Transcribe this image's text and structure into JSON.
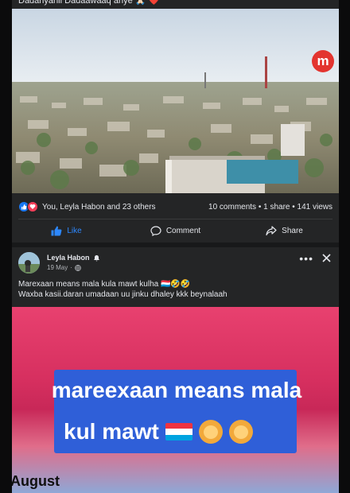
{
  "post1": {
    "caption_top": "Dadanyarlii Dadaawaaq ahye 🙏🏻 ❤️",
    "watermark": "m",
    "reactions": {
      "reactors": "You, Leyla Habon and 23 others",
      "stats": "10 comments • 1 share • 141 views"
    },
    "actions": {
      "like": "Like",
      "comment": "Comment",
      "share": "Share"
    }
  },
  "post2": {
    "author": "Leyla Habon",
    "date": "19 May",
    "date_sep": "·",
    "caption_line1": "Marexaan means mala kula mawt kulha 🇱🇺🤣🤣",
    "caption_line2": "Waxba kasii.daran umadaan uu jinku dhaley kkk beynalaah",
    "media": {
      "banner_line1": "mareexaan means mala",
      "banner_line2": "kul mawt",
      "bottom_text": "August"
    }
  },
  "colors": {
    "accent": "#2d88ff",
    "like": "#1877f2",
    "love": "#f33e58",
    "surface": "#242526",
    "banner": "#2f5fd8"
  },
  "icons": [
    "like-reaction-icon",
    "love-reaction-icon",
    "thumbs-up-icon",
    "comment-icon",
    "share-icon",
    "bell-icon",
    "globe-icon",
    "more-icon",
    "close-icon"
  ]
}
